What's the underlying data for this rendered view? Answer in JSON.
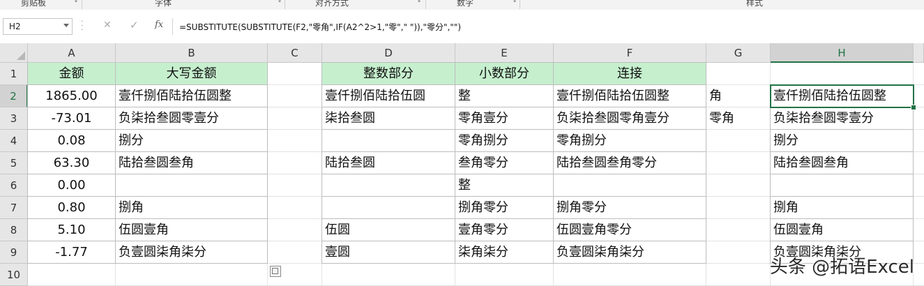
{
  "ribbon": {
    "groups": [
      {
        "label": "剪贴板"
      },
      {
        "label": "字体"
      },
      {
        "label": "对齐方式"
      },
      {
        "label": "数字"
      },
      {
        "label": "样式"
      }
    ]
  },
  "formula_bar": {
    "name_box": "H2",
    "cancel_icon": "✕",
    "enter_icon": "✓",
    "fx_label": "fx",
    "formula": "=SUBSTITUTE(SUBSTITUTE(F2,\"零角\",IF(A2^2>1,\"零\",\" \")),\"零分\",\"\")"
  },
  "sheet": {
    "columns": [
      "A",
      "B",
      "C",
      "D",
      "E",
      "F",
      "G",
      "H"
    ],
    "rows": [
      "1",
      "2",
      "3",
      "4",
      "5",
      "6",
      "7",
      "8",
      "9",
      "10"
    ],
    "selected_column": "H",
    "selected_row": "2",
    "fill_color": "#c6efce",
    "cells": {
      "A1": "金额",
      "B1": "大写金额",
      "D1": "整数部分",
      "E1": "小数部分",
      "F1": "连接",
      "A2": "1865.00",
      "B2": "壹仟捌佰陆拾伍圆整",
      "D2": "壹仟捌佰陆拾伍圆",
      "E2": "整",
      "F2": "壹仟捌佰陆拾伍圆整",
      "G2": "角",
      "H2": "壹仟捌佰陆拾伍圆整",
      "A3": "-73.01",
      "B3": "负柒拾叁圆零壹分",
      "D3": "柒拾叁圆",
      "E3": "零角壹分",
      "F3": "负柒拾叁圆零角壹分",
      "G3": "零角",
      "H3": "负柒拾叁圆零壹分",
      "A4": "0.08",
      "B4": " 捌分",
      "D4": "",
      "E4": "零角捌分",
      "F4": "零角捌分",
      "G4": "",
      "H4": " 捌分",
      "A5": "63.30",
      "B5": "陆拾叁圆叁角",
      "D5": "陆拾叁圆",
      "E5": "叁角零分",
      "F5": "陆拾叁圆叁角零分",
      "G5": "",
      "H5": "陆拾叁圆叁角",
      "A6": "0.00",
      "B6": "",
      "D6": "",
      "E6": "整",
      "F6": "",
      "G6": "",
      "H6": "",
      "A7": "0.80",
      "B7": "捌角",
      "D7": "",
      "E7": "捌角零分",
      "F7": "捌角零分",
      "G7": "",
      "H7": "捌角",
      "A8": "5.10",
      "B8": "伍圆壹角",
      "D8": "伍圆",
      "E8": "壹角零分",
      "F8": "伍圆壹角零分",
      "G8": "",
      "H8": "伍圆壹角",
      "A9": "-1.77",
      "B9": "负壹圆柒角柒分",
      "D9": "壹圆",
      "E9": "柒角柒分",
      "F9": "负壹圆柒角柒分",
      "G9": "",
      "H9": "负壹圆柒角柒分"
    }
  },
  "watermark": "头条 @拓语Excel"
}
